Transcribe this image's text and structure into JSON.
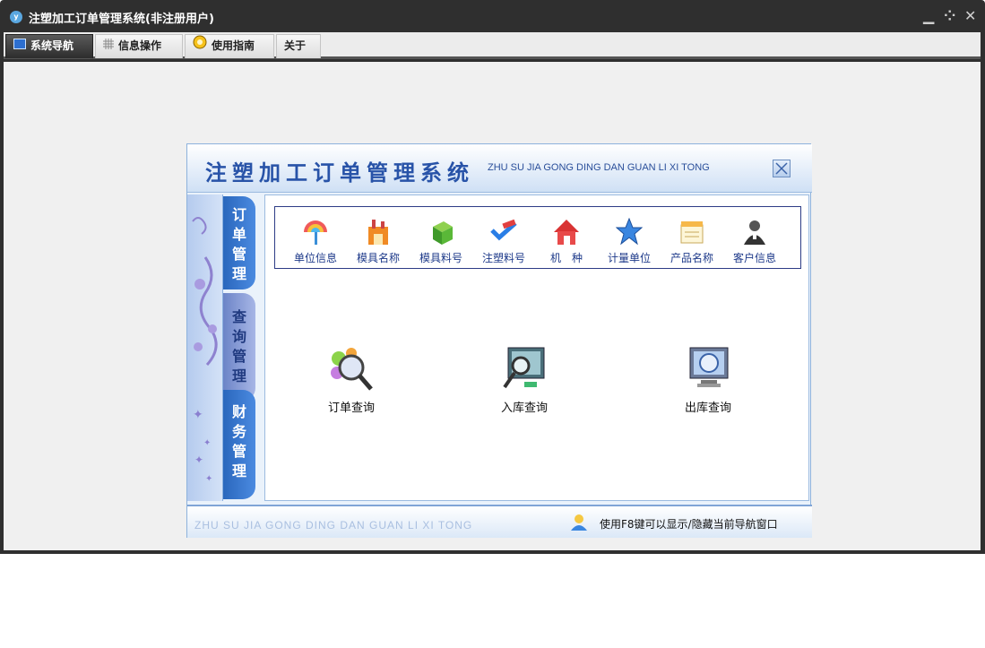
{
  "window": {
    "logo_text": "y",
    "title": "注塑加工订单管理系统(非注册用户)",
    "controls": {
      "minimize": "▁",
      "restore": "⁘",
      "close": "✕"
    }
  },
  "menu": {
    "tabs": [
      {
        "label": "系统导航",
        "icon": "monitor-icon",
        "active": true
      },
      {
        "label": "信息操作",
        "icon": "grid-icon"
      },
      {
        "label": "使用指南",
        "icon": "guide-icon"
      },
      {
        "label": "关于"
      }
    ]
  },
  "nav": {
    "title": "注塑加工订单管理系统",
    "subtitle": "ZHU SU JIA GONG DING DAN GUAN LI XI TONG",
    "side_tabs": [
      {
        "label": "订单管理"
      },
      {
        "label": "查询管理",
        "selected": true
      },
      {
        "label": "财务管理"
      }
    ],
    "quick_items": [
      {
        "label": "单位信息",
        "icon": "rainbow-umbrella-icon"
      },
      {
        "label": "模具名称",
        "icon": "factory-icon"
      },
      {
        "label": "模具料号",
        "icon": "green-box-icon"
      },
      {
        "label": "注塑料号",
        "icon": "pen-check-icon"
      },
      {
        "label": "机　种",
        "icon": "house-icon"
      },
      {
        "label": "计量单位",
        "icon": "star-icon"
      },
      {
        "label": "产品名称",
        "icon": "notepad-icon"
      },
      {
        "label": "客户信息",
        "icon": "person-icon"
      }
    ],
    "query_items": [
      {
        "label": "订单查询",
        "icon": "magnifier-icon"
      },
      {
        "label": "入库查询",
        "icon": "monitor-search-icon"
      },
      {
        "label": "出库查询",
        "icon": "monitor-scan-icon"
      }
    ],
    "footer": {
      "subtitle": "ZHU SU JIA GONG DING DAN GUAN LI XI TONG",
      "hint": "使用F8键可以显示/隐藏当前导航窗口"
    }
  }
}
